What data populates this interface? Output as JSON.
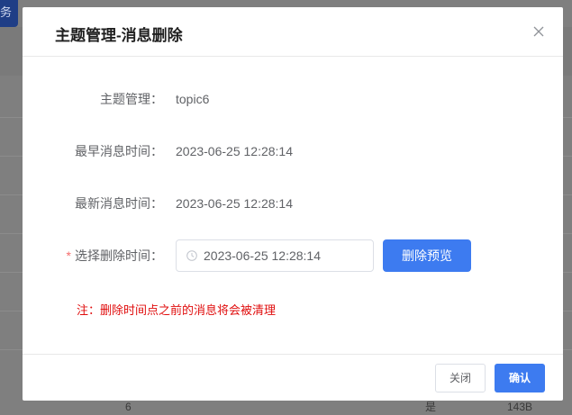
{
  "background": {
    "corner_button_label": "务",
    "bottom_row": {
      "col1": "6",
      "col2": "是",
      "col3": "143B"
    }
  },
  "modal": {
    "title": "主题管理-消息删除",
    "close_icon": "close-icon",
    "fields": {
      "topic": {
        "label": "主题管理：",
        "value": "topic6"
      },
      "earliest": {
        "label": "最早消息时间：",
        "value": "2023-06-25 12:28:14"
      },
      "latest": {
        "label": "最新消息时间：",
        "value": "2023-06-25 12:28:14"
      },
      "delete_time": {
        "required_mark": "*",
        "label": "选择删除时间：",
        "value": "2023-06-25 12:28:14",
        "icon": "clock-icon"
      }
    },
    "preview_button": "删除预览",
    "note": "注：删除时间点之前的消息将会被清理",
    "footer": {
      "close_label": "关闭",
      "confirm_label": "确认"
    }
  },
  "colors": {
    "primary": "#3d7bf0",
    "danger": "#e00d0d",
    "overlay": "#7f7f7f"
  }
}
